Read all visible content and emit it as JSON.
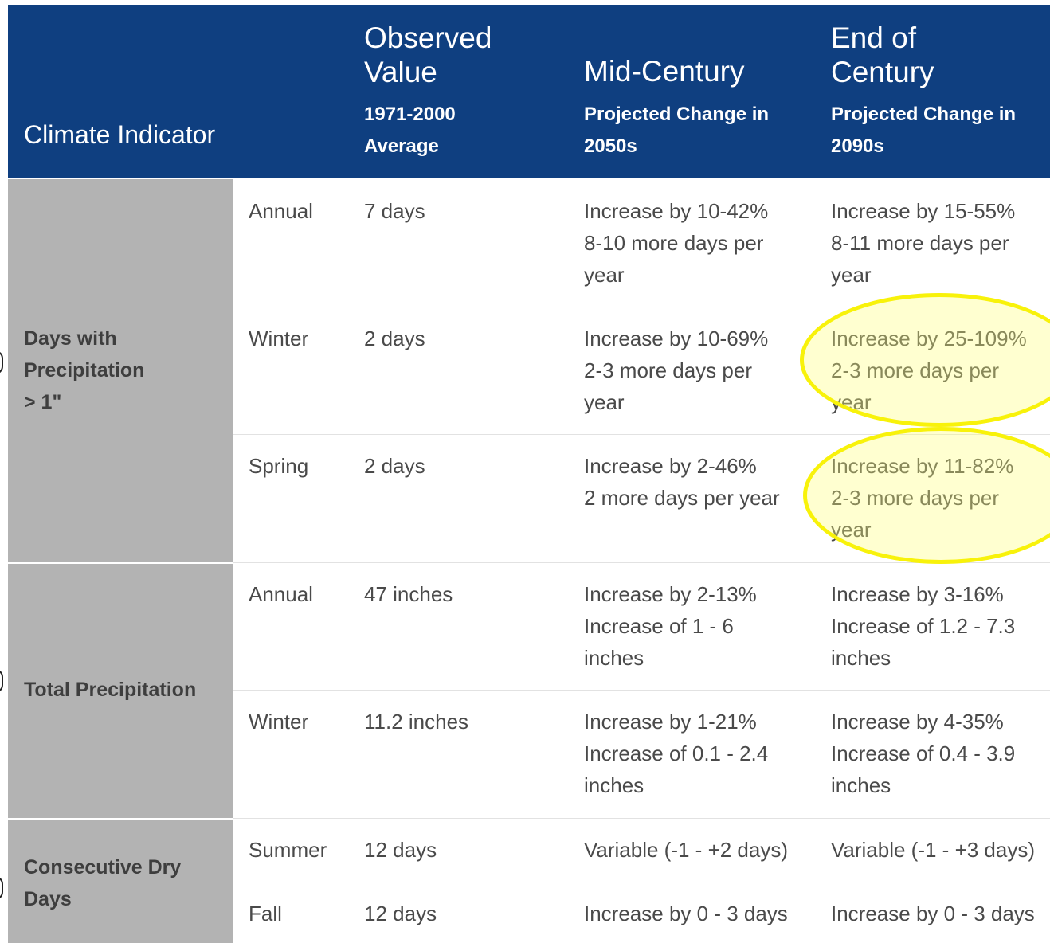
{
  "header": {
    "climate_indicator": "Climate Indicator",
    "observed": {
      "title": "Observed\nValue",
      "sub": "1971-2000\nAverage"
    },
    "mid": {
      "title": "Mid-Century",
      "sub": "Projected Change in\n2050s"
    },
    "end": {
      "title": "End of\nCentury",
      "sub": "Projected Change in\n2090s"
    }
  },
  "groups": [
    {
      "label": "Days with\nPrecipitation\n> 1\""
    },
    {
      "label": "Total Precipitation"
    },
    {
      "label": "Consecutive Dry\nDays"
    }
  ],
  "rows": [
    {
      "season": "Annual",
      "observed": "7 days",
      "mid": "Increase by 10-42%\n8-10 more days per\nyear",
      "end": "Increase by 15-55%\n8-11 more days per\nyear"
    },
    {
      "season": "Winter",
      "observed": "2 days",
      "mid": "Increase by 10-69%\n2-3 more days per\nyear",
      "end": "Increase by 25-109%\n2-3 more days per\nyear"
    },
    {
      "season": "Spring",
      "observed": "2 days",
      "mid": "Increase by 2-46%\n2 more days per year",
      "end": "Increase by 11-82%\n2-3 more days per\nyear"
    },
    {
      "season": "Annual",
      "observed": "47 inches",
      "mid": "Increase by 2-13%\nIncrease of 1 - 6\ninches",
      "end": "Increase by 3-16%\nIncrease of 1.2 - 7.3\ninches"
    },
    {
      "season": "Winter",
      "observed": "11.2 inches",
      "mid": "Increase by 1-21%\nIncrease of 0.1 - 2.4\ninches",
      "end": "Increase by 4-35%\nIncrease of 0.4 - 3.9\ninches"
    },
    {
      "season": "Summer",
      "observed": "12 days",
      "mid": "Variable (-1 - +2 days)",
      "end": "Variable (-1 - +3 days)"
    },
    {
      "season": "Fall",
      "observed": "12 days",
      "mid": "Increase by 0 - 3 days",
      "end": "Increase by 0 - 3 days"
    }
  ],
  "colors": {
    "header_bg": "#0f3f80",
    "group_bg": "#b3b3b3",
    "highlight": "#f8f20a"
  }
}
